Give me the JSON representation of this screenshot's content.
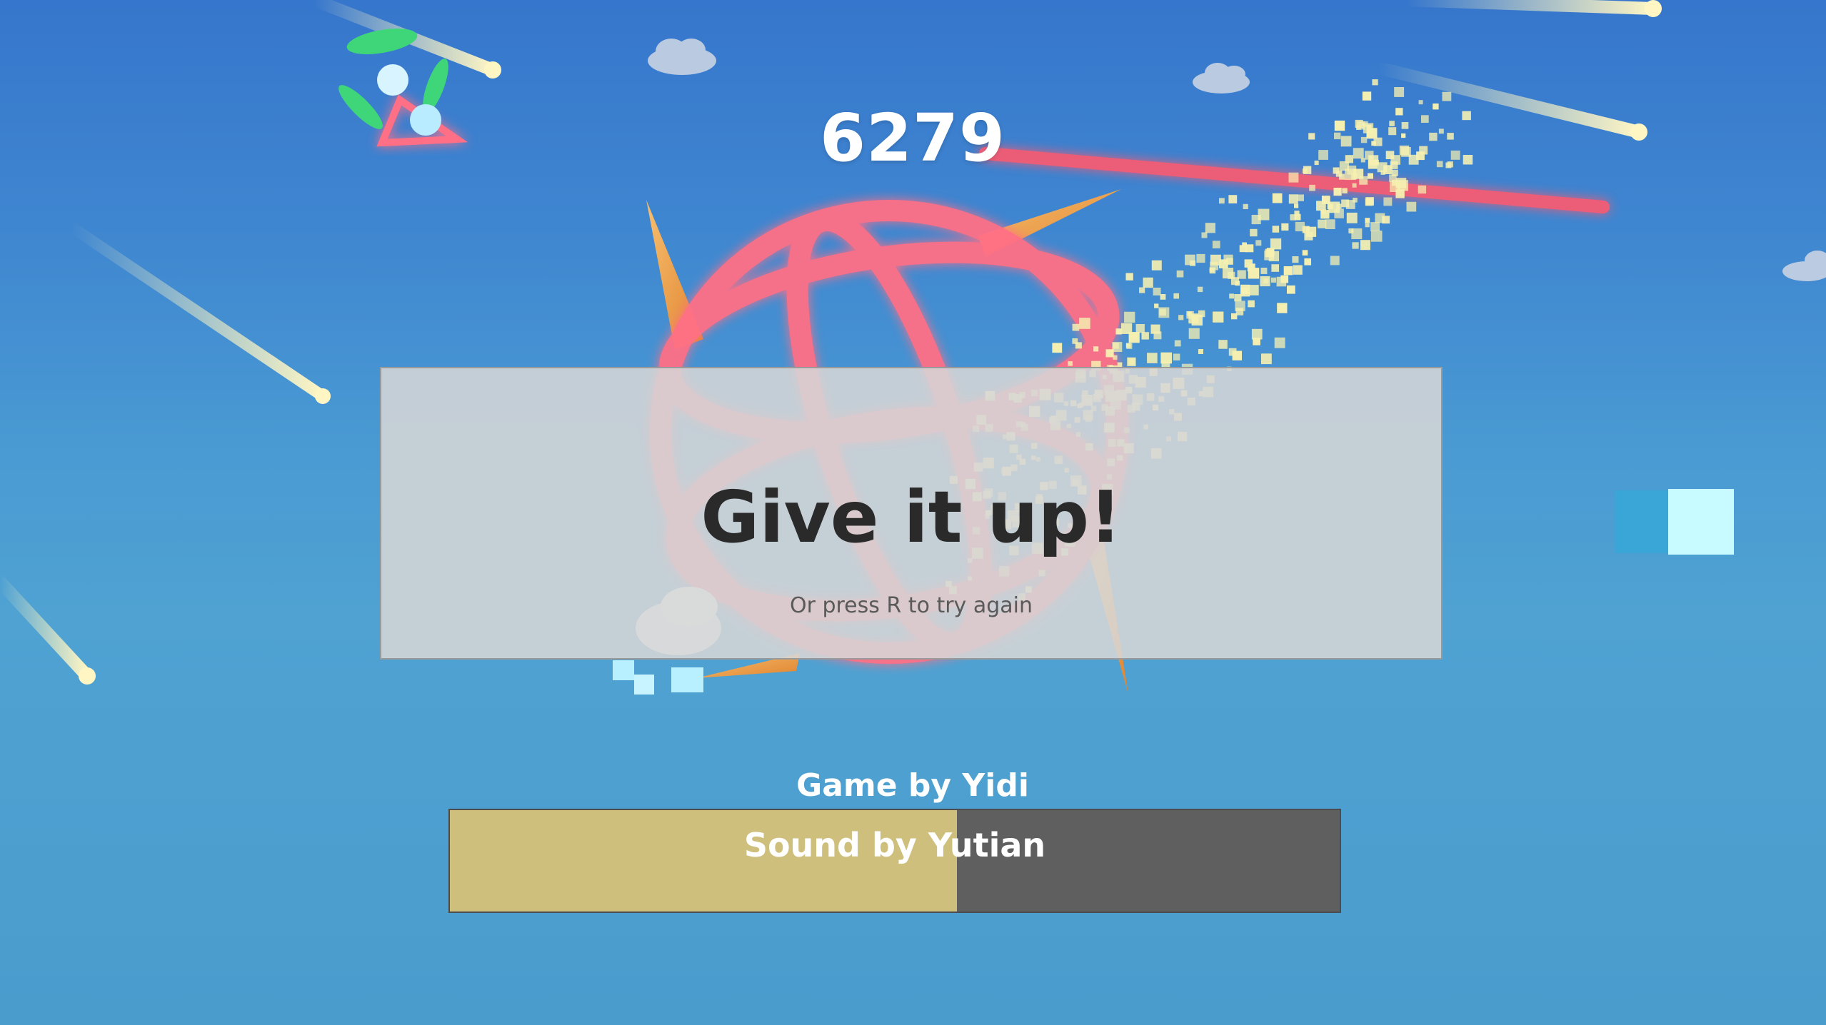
{
  "hud": {
    "score": "6279"
  },
  "dialog": {
    "title": "Give it up!",
    "subtitle": "Or press R to try again"
  },
  "credits": {
    "game": "Game by Yidi",
    "sound": "Sound by Yutian"
  },
  "progress": {
    "fraction": 0.57
  },
  "colors": {
    "sky_top": "#3676cc",
    "sky_bottom": "#4fa2d2",
    "laser": "#ff5a6e",
    "ring": "#ff6f86",
    "spike": "#f0a04a",
    "comet": "#fff6c4",
    "particle": "#f6f0b0",
    "bar_fill": "#cfbf7d",
    "bar_track": "#5f5f5f"
  }
}
